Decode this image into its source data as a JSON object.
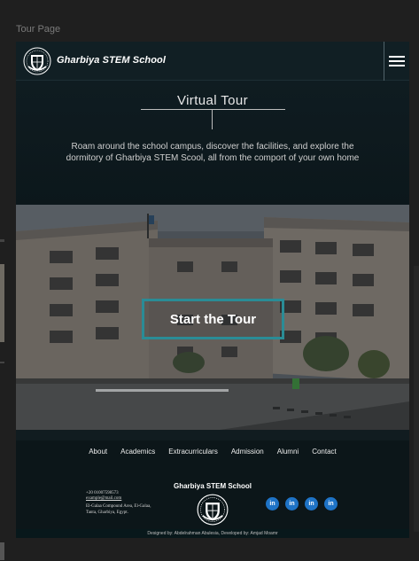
{
  "canvas": {
    "label": "Tour Page"
  },
  "header": {
    "school_name": "Gharbiya STEM School",
    "menu_icon": "hamburger-menu-icon",
    "logo_icon": "school-crest-logo"
  },
  "intro": {
    "title": "Virtual Tour",
    "description": "Roam around the school campus, discover the facilities, and explore the dormitory of Gharbiya STEM Scool, all from the comport of your own home"
  },
  "hero": {
    "button_label": "Start the Tour"
  },
  "footer": {
    "nav": [
      "About",
      "Academics",
      "Extracurriculars",
      "Admission",
      "Alumni",
      "Contact"
    ],
    "school_name": "Gharbiya STEM School",
    "phone": "+20 01007598573",
    "email": "example@mail.com",
    "address_line1": "El-Galaa Compound Area, El-Galaa,",
    "address_line2": "Tanta, Gharbiya, Egypt.",
    "social_label": "in",
    "social_icon": "linkedin-icon",
    "credits": "Designed by: Abdelrahman Abulesia, Developed by: Amjad Moamr"
  },
  "colors": {
    "accent": "#2a8c96",
    "linkedin": "#1e73c6",
    "background": "#0e1a1e"
  }
}
